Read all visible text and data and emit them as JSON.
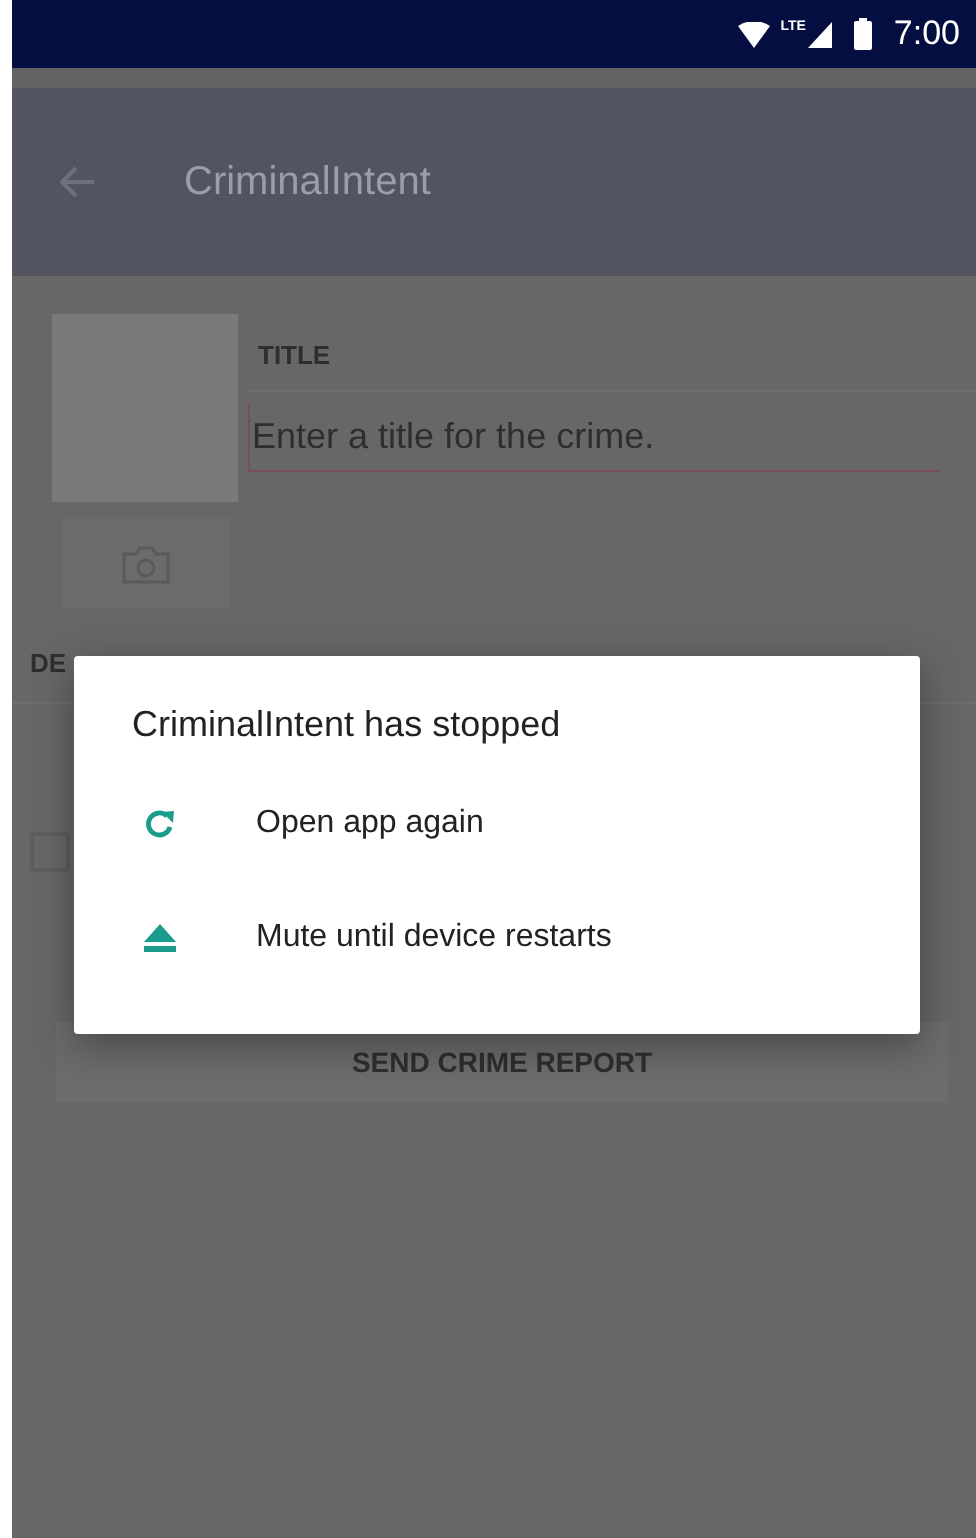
{
  "status_bar": {
    "network": "LTE",
    "time": "7:00"
  },
  "app_bar": {
    "title": "CriminalIntent"
  },
  "crime_form": {
    "title_label": "TITLE",
    "title_field": {
      "placeholder": "Enter a title for the crime."
    },
    "details_label": "DE",
    "solved_checkbox": {
      "checked": false
    },
    "report_button": "SEND CRIME REPORT"
  },
  "dialog": {
    "title": "CriminalIntent has stopped",
    "items": [
      {
        "kind": "reopen",
        "label": "Open app again"
      },
      {
        "kind": "mute",
        "label": "Mute until device restarts"
      }
    ]
  }
}
